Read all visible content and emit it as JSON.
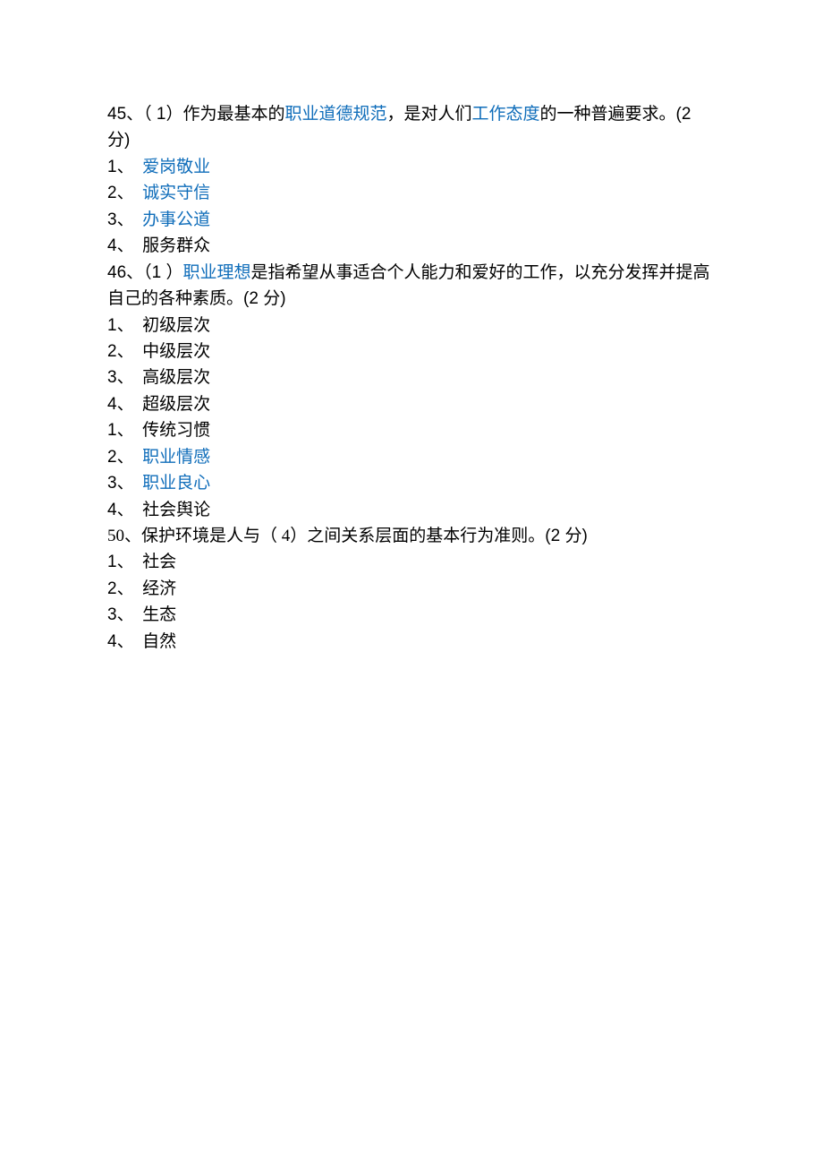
{
  "q45": {
    "prefix": "45、（ 1）作为最基本的",
    "link1": "职业道德规范",
    "mid1": "，是对人们",
    "link2": "工作态度",
    "mid2": "的一种普遍要求。",
    "points": "(2 分)",
    "options": [
      {
        "prefix": "1、　",
        "text": "爱岗敬业",
        "link": true
      },
      {
        "prefix": "2、　",
        "text": "诚实守信",
        "link": true
      },
      {
        "prefix": "3、　",
        "text": "办事公道",
        "link": true
      },
      {
        "prefix": "4、　",
        "text": "服务群众",
        "link": false
      }
    ]
  },
  "q46": {
    "prefix": "46、（1 ）",
    "link1": "职业理想",
    "rest": "是指希望从事适合个人能力和爱好的工作，以充分发挥并提高自己的各种素质。",
    "points": "(2 分)",
    "options": [
      {
        "prefix": "1、　",
        "text": "初级层次",
        "link": false
      },
      {
        "prefix": "2、　",
        "text": "中级层次",
        "link": false
      },
      {
        "prefix": "3、　",
        "text": "高级层次",
        "link": false
      },
      {
        "prefix": "4、　",
        "text": "超级层次",
        "link": false
      }
    ]
  },
  "block_extra": {
    "options": [
      {
        "prefix": "1、　",
        "text": "传统习惯",
        "link": false
      },
      {
        "prefix": "2、　",
        "text": "职业情感",
        "link": true
      },
      {
        "prefix": "3、　",
        "text": "职业良心",
        "link": true
      },
      {
        "prefix": "4、　",
        "text": "社会舆论",
        "link": false
      }
    ]
  },
  "q50": {
    "line": "50、保护环境是人与（ 4）之间关系层面的基本行为准则。",
    "points": "(2 分)",
    "options": [
      {
        "prefix": "1、　",
        "text": "社会",
        "link": false
      },
      {
        "prefix": "2、　",
        "text": "经济",
        "link": false
      },
      {
        "prefix": "3、　",
        "text": "生态",
        "link": false
      },
      {
        "prefix": "4、　",
        "text": "自然",
        "link": false
      }
    ]
  }
}
